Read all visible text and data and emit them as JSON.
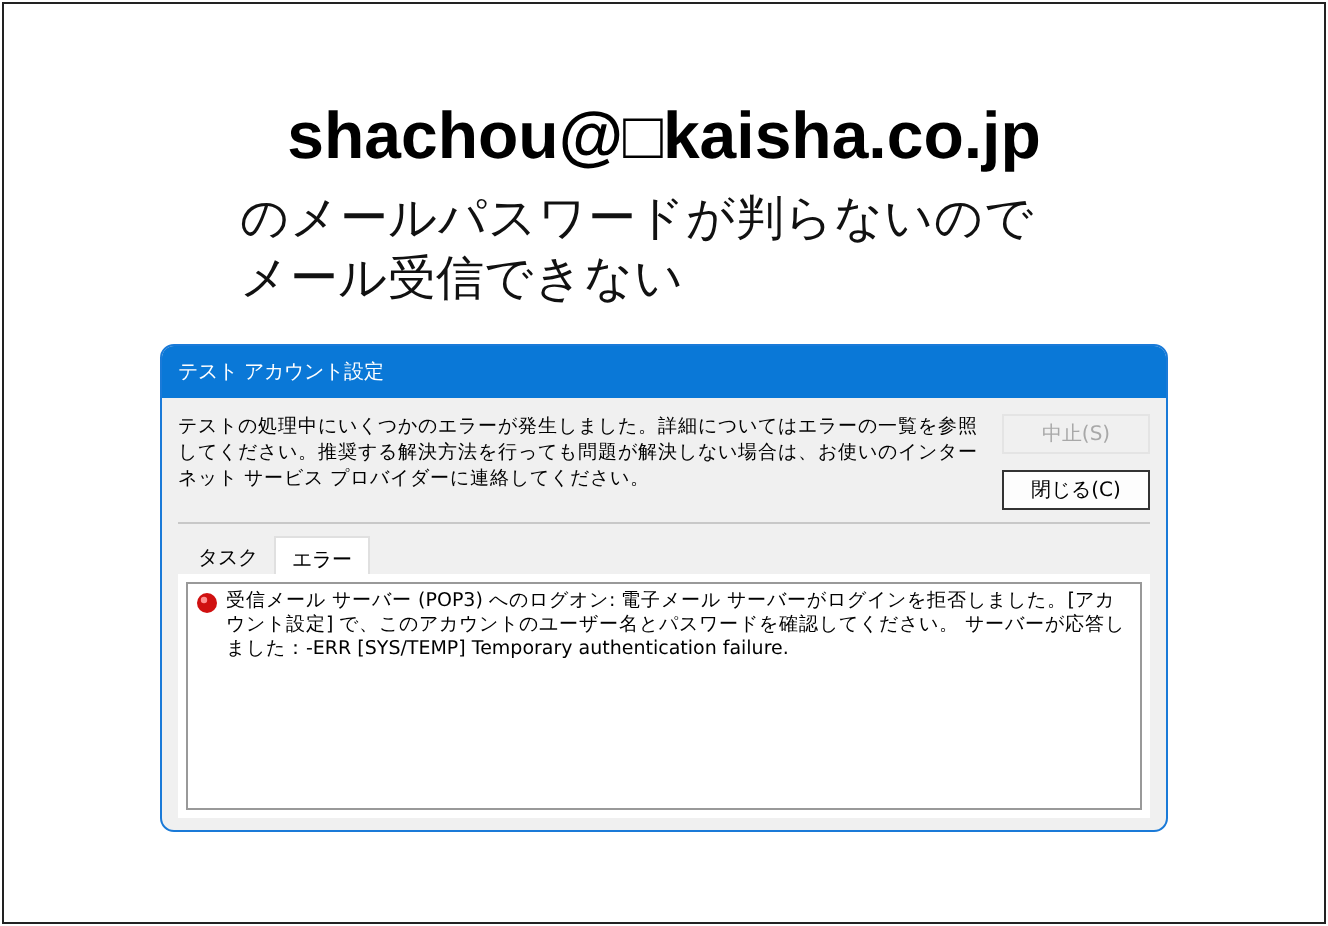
{
  "heading": "shachou@□kaisha.co.jp",
  "subtitle": [
    "のメールパスワードが判らないので",
    "メール受信できない"
  ],
  "dialog": {
    "title": "テスト アカウント設定",
    "message": "テストの処理中にいくつかのエラーが発生しました。詳細についてはエラーの一覧を参照してください。推奨する解決方法を行っても問題が解決しない場合は、お使いのインターネット サービス プロバイダーに連絡してください。",
    "buttons": [
      {
        "label": "中止(S)",
        "disabled": true
      },
      {
        "label": "閉じる(C)",
        "disabled": false
      }
    ],
    "tabs": [
      {
        "label": "タスク",
        "selected": false
      },
      {
        "label": "エラー",
        "selected": true
      }
    ],
    "errors": [
      {
        "text": "受信メール サーバー (POP3) へのログオン: 電子メール サーバーがログインを拒否しました。[アカウント設定] で、このアカウントのユーザー名とパスワードを確認してください。 サーバーが応答しました：-ERR [SYS/TEMP] Temporary authentication failure."
      }
    ]
  }
}
